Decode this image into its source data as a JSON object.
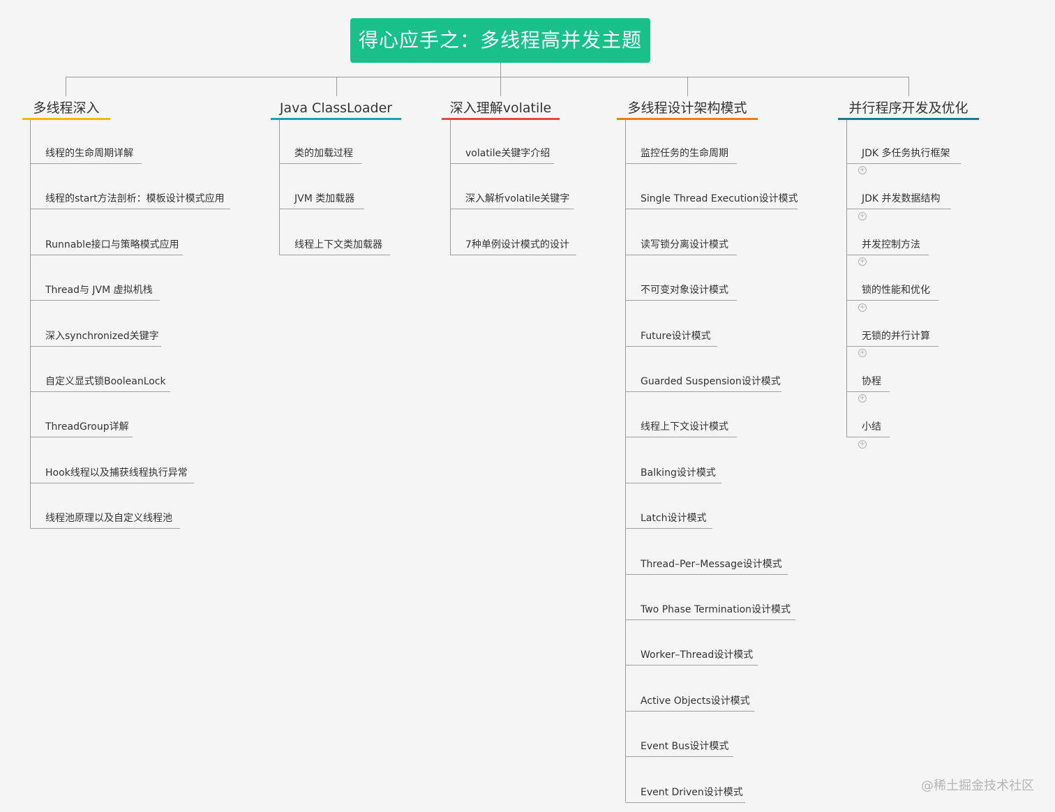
{
  "title": "得心应手之：多线程高并发主题",
  "watermark": "@稀土掘金技术社区",
  "colors": {
    "root_bg": "#19c08a",
    "branch_1": "#f5b700",
    "branch_2": "#1f9fb3",
    "branch_3": "#e8473c",
    "branch_4": "#f07b12",
    "branch_5": "#1a7c91"
  },
  "branches": [
    {
      "label": "多线程深入",
      "items": [
        "线程的生命周期详解",
        "线程的start方法剖析：模板设计模式应用",
        "Runnable接口与策略模式应用",
        "Thread与 JVM 虚拟机栈",
        "深入synchronized关键字",
        "自定义显式锁BooleanLock",
        "ThreadGroup详解",
        "Hook线程以及捕获线程执行异常",
        "线程池原理以及自定义线程池"
      ]
    },
    {
      "label": "Java ClassLoader",
      "items": [
        "类的加载过程",
        "JVM 类加载器",
        "线程上下文类加载器"
      ]
    },
    {
      "label": "深入理解volatile",
      "items": [
        "volatile关键字介绍",
        "深入解析volatile关键字",
        "7种单例设计模式的设计"
      ]
    },
    {
      "label": "多线程设计架构模式",
      "items": [
        "监控任务的生命周期",
        "Single Thread Execution设计模式",
        "读写锁分离设计模式",
        "不可变对象设计模式",
        "Future设计模式",
        "Guarded Suspension设计模式",
        "线程上下文设计模式",
        "Balking设计模式",
        "Latch设计模式",
        "Thread–Per–Message设计模式",
        "Two Phase Termination设计模式",
        "Worker–Thread设计模式",
        "Active Objects设计模式",
        "Event Bus设计模式",
        "Event Driven设计模式"
      ]
    },
    {
      "label": "并行程序开发及优化",
      "items": [
        "JDK 多任务执行框架",
        "JDK 并发数据结构",
        "并发控制方法",
        "锁的性能和优化",
        "无锁的并行计算",
        "协程",
        "小结"
      ],
      "collapsed": true,
      "expand_icon": "plus-circle-icon"
    }
  ]
}
